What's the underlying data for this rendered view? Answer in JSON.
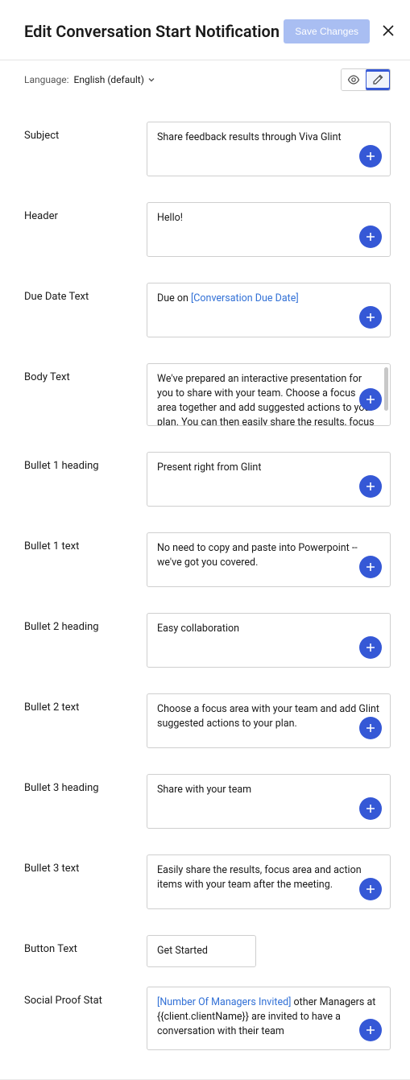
{
  "title": "Edit Conversation Start Notification",
  "save_label": "Save Changes",
  "language_label": "Language:",
  "language_value": "English (default)",
  "fields": {
    "subject": {
      "label": "Subject",
      "value": "Share feedback results through Viva Glint"
    },
    "header": {
      "label": "Header",
      "value": "Hello!"
    },
    "due_date": {
      "label": "Due Date Text",
      "prefix": "Due on ",
      "token": "[Conversation Due Date]"
    },
    "body": {
      "label": "Body Text",
      "value": "We've prepared an interactive presentation for you to share with your team. Choose a focus area together and add suggested actions to your plan. You can then easily share the results, focus area, and action items after the meeting"
    },
    "b1h": {
      "label": "Bullet 1 heading",
      "value": "Present right from Glint"
    },
    "b1t": {
      "label": "Bullet 1 text",
      "value": "No need to copy and paste into Powerpoint -- we've got you covered."
    },
    "b2h": {
      "label": "Bullet 2 heading",
      "value": "Easy collaboration"
    },
    "b2t": {
      "label": "Bullet 2 text",
      "value": "Choose a focus area with your team and add Glint suggested actions to your plan."
    },
    "b3h": {
      "label": "Bullet 3 heading",
      "value": "Share with your team"
    },
    "b3t": {
      "label": "Bullet 3 text",
      "value": "Easily share the results, focus area and action items with your team after the meeting."
    },
    "button_text": {
      "label": "Button Text",
      "value": "Get Started"
    },
    "social": {
      "label": "Social Proof Stat",
      "token": "[Number Of Managers Invited]",
      "rest": " other Managers at {{client.clientName}} are invited to have a conversation with their team"
    }
  }
}
